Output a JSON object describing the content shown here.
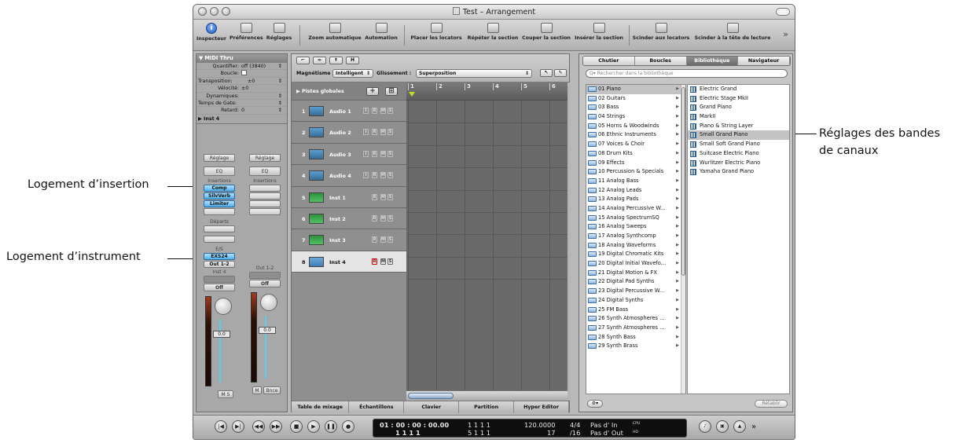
{
  "callouts": {
    "insert_slot": "Logement d’insertion",
    "instrument_slot": "Logement d’instrument",
    "channel_strip_settings_line1": "Réglages des bandes",
    "channel_strip_settings_line2": "de canaux"
  },
  "window": {
    "title": "Test – Arrangement"
  },
  "toolbar": {
    "items": [
      {
        "label": "Inspecteur",
        "icon": "info-icon"
      },
      {
        "label": "Préférences",
        "icon": "preferences-icon"
      },
      {
        "label": "Réglages",
        "icon": "settings-icon"
      },
      {
        "label": "Zoom automatique",
        "icon": "zoom-icon"
      },
      {
        "label": "Automation",
        "icon": "automation-icon"
      },
      {
        "label": "Placer les locators",
        "icon": "set-locators-icon"
      },
      {
        "label": "Répéter la section",
        "icon": "repeat-section-icon"
      },
      {
        "label": "Couper la section",
        "icon": "cut-section-icon"
      },
      {
        "label": "Insérer la section",
        "icon": "insert-section-icon"
      },
      {
        "label": "Scinder aux locators",
        "icon": "split-locators-icon"
      },
      {
        "label": "Scinder à la tête de lecture",
        "icon": "split-playhead-icon"
      }
    ],
    "more": "»"
  },
  "inspector": {
    "header": "▼ MIDI Thru",
    "rows": [
      {
        "key": "Quantifier:",
        "value": "off (3840)"
      },
      {
        "key": "Boucle:",
        "value": ""
      },
      {
        "key": "Transposition:",
        "value": "±0"
      },
      {
        "key": "Vélocité:",
        "value": "±0"
      },
      {
        "key": "Dynamiques:",
        "value": ""
      },
      {
        "key": "Temps de Gate:",
        "value": ""
      },
      {
        "key": "Retard:",
        "value": "0"
      }
    ],
    "track_header": "▶ Inst 4",
    "strip1": {
      "setting": "Réglage",
      "eq": "EQ",
      "inserts_label": "Insertions",
      "inserts": [
        "Comp",
        "SilvVerb",
        "Limiter"
      ],
      "sends_label": "Départs",
      "io_label": "E/S",
      "input": "EXS24",
      "output": "Out 1-2",
      "name": "Inst 4",
      "automation": "Off",
      "volume": "0.0",
      "buttons": "M S"
    },
    "strip2": {
      "setting": "Réglage",
      "eq": "EQ",
      "inserts_label": "Insertions",
      "name": "Out 1-2",
      "automation": "Off",
      "volume": "0.0",
      "buttons": "M",
      "bnce": "Bnce"
    }
  },
  "arrange": {
    "snap_label": "Magnétisme :",
    "snap_value": "Intelligent",
    "drag_label": "Glissement :",
    "drag_value": "Superposition",
    "global_tracks": "▶ Pistes globales",
    "ruler": [
      "1",
      "2",
      "3",
      "4",
      "5",
      "6"
    ],
    "tracks": [
      {
        "num": "1",
        "name": "Audio 1",
        "type": "audio"
      },
      {
        "num": "2",
        "name": "Audio 2",
        "type": "audio"
      },
      {
        "num": "3",
        "name": "Audio 3",
        "type": "audio"
      },
      {
        "num": "4",
        "name": "Audio 4",
        "type": "audio"
      },
      {
        "num": "5",
        "name": "Inst 1",
        "type": "inst"
      },
      {
        "num": "6",
        "name": "Inst 2",
        "type": "inst"
      },
      {
        "num": "7",
        "name": "Inst 3",
        "type": "inst"
      },
      {
        "num": "8",
        "name": "Inst 4",
        "type": "exs",
        "selected": true
      }
    ],
    "bottom_tabs": [
      "Table de mixage",
      "Échantillons",
      "Clavier",
      "Partition",
      "Hyper Editor"
    ]
  },
  "library": {
    "tabs": [
      "Chutier",
      "Boucles",
      "Bibliothèque",
      "Navigateur"
    ],
    "active_tab": "Bibliothèque",
    "search_placeholder": "Rechercher dans la bibliothèque",
    "categories": [
      "01 Piano",
      "02 Guitars",
      "03 Bass",
      "04 Strings",
      "05 Horns & Woodwinds",
      "06 Ethnic Instruments",
      "07 Voices & Choir",
      "08 Drum Kits",
      "09 Effects",
      "10 Percussion & Specials",
      "11 Analog Bass",
      "12 Analog Leads",
      "13 Analog Pads",
      "14 Analog Percussive W...",
      "15 Analog SpectrumSQ",
      "16 Analog Sweeps",
      "17 Analog Synthcomp",
      "18 Analog Waveforms",
      "19 Digital Chromatic Kits",
      "20 Digital Initial Wavefo...",
      "21 Digital Motion & FX",
      "22 Digital Pad Synths",
      "23 Digital Percussive W...",
      "24 Digital Synths",
      "25 FM Bass",
      "26 Synth Atmospheres ...",
      "27 Synth Atmospheres ...",
      "28 Synth Bass",
      "29 Synth Brass"
    ],
    "selected_category": "01 Piano",
    "patches": [
      "Electric Grand",
      "Electric Stage MkII",
      "Grand Piano",
      "MarkII",
      "Piano & String Layer",
      "Small Grand Piano",
      "Small Soft Grand Piano",
      "Suitcase Electric Piano",
      "Wurlitzer Electric Piano",
      "Yamaha Grand Piano"
    ],
    "selected_patch": "Small Grand Piano",
    "reset": "Rétablir"
  },
  "transport": {
    "smpte": "01 : 00 : 00 : 00.00",
    "bars": "1   1   1   1",
    "left": "1   1   1   1",
    "left2": "5   1   1   1",
    "tempo": "120.0000",
    "tempo2": "17",
    "sig": "4/4",
    "div": "/16",
    "in": "Pas d' In",
    "out": "Pas d' Out",
    "cpu": "CPU",
    "hd": "HD"
  }
}
